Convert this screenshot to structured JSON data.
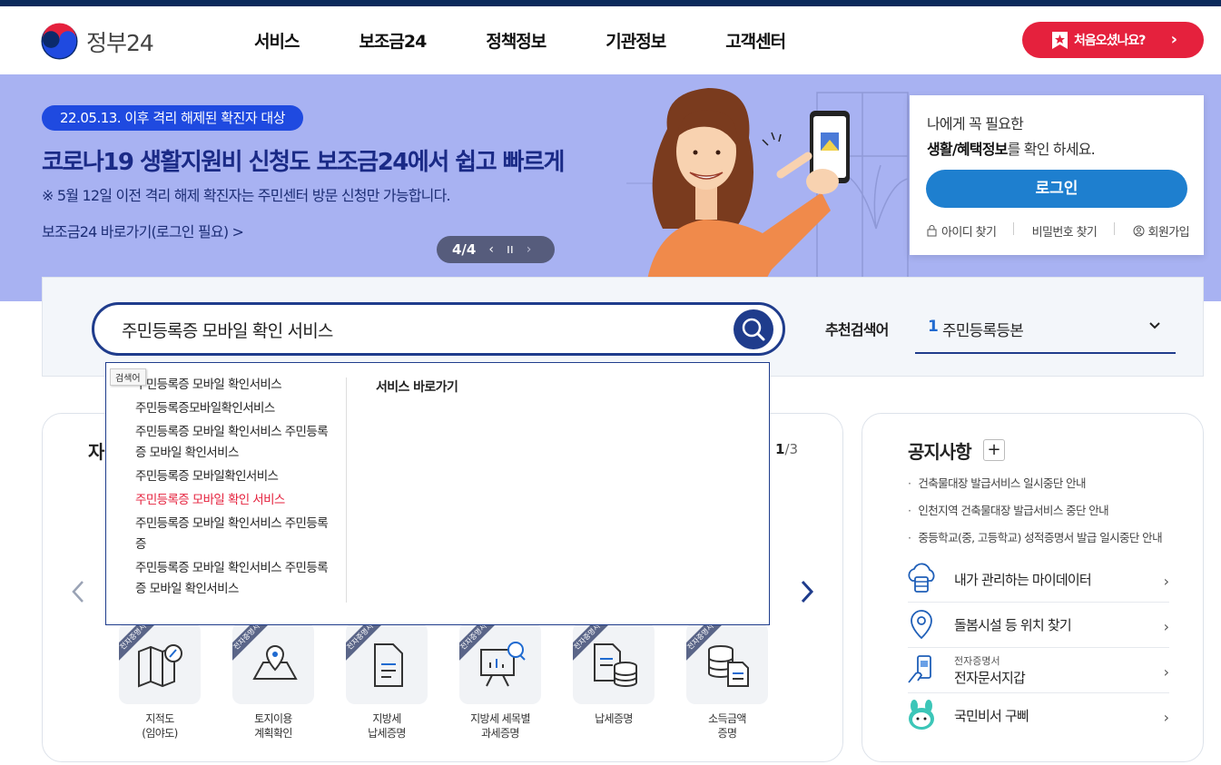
{
  "header": {
    "logo_text": "정부24",
    "nav": [
      "서비스",
      "보조금24",
      "정책정보",
      "기관정보",
      "고객센터"
    ],
    "first_visit_label": "처음오셨나요?"
  },
  "banner": {
    "badge": "22.05.13. 이후 격리 해제된 확진자 대상",
    "title": "코로나19 생활지원비 신청도 보조금24에서 쉽고 빠르게",
    "subtitle": "※ 5월 12일 이전 격리 해제 확진자는 주민센터 방문 신청만 가능합니다.",
    "link": "보조금24 바로가기(로그인 필요) >",
    "pager": "4/4"
  },
  "login": {
    "line1": "나에게 꼭 필요한",
    "line2_bold": "생활/혜택정보",
    "line2_rest": "를 확인 하세요.",
    "button": "로그인",
    "find_id": "아이디 찾기",
    "find_pw": "비밀번호 찾기",
    "signup": "회원가입"
  },
  "search": {
    "value": "주민등록증 모바일 확인 서비스",
    "recommend_label": "추천검색어",
    "recommend_num": "1",
    "recommend_text": "주민등록등본"
  },
  "autocomplete": {
    "tooltip": "검색어",
    "items": [
      {
        "text": "주민등록증 모바일 확인서비스",
        "hl": false
      },
      {
        "text": "주민등록증모바일확인서비스",
        "hl": false
      },
      {
        "text": "주민등록증 모바일 확인서비스 주민등록증 모바일 확인서비스",
        "hl": false
      },
      {
        "text": "주민등록증 모바일확인서비스",
        "hl": false
      },
      {
        "text": "주민등록증 모바일 확인 서비스",
        "hl": true
      },
      {
        "text": "주민등록증 모바일 확인서비스 주민등록증",
        "hl": false
      },
      {
        "text": "주민등록증 모바일 확인서비스 주민등록증 모바일 확인서비스",
        "hl": false
      }
    ],
    "right_title": "서비스 바로가기"
  },
  "services_card": {
    "title": "자",
    "page_current": "1",
    "page_total": "/3",
    "ribbon": "전자증명서",
    "items": [
      {
        "line1": "지적도",
        "line2": "(임야도)"
      },
      {
        "line1": "토지이용",
        "line2": "계획확인"
      },
      {
        "line1": "지방세",
        "line2": "납세증명"
      },
      {
        "line1": "지방세 세목별",
        "line2": "과세증명"
      },
      {
        "line1": "납세증명",
        "line2": ""
      },
      {
        "line1": "소득금액",
        "line2": "증명"
      }
    ]
  },
  "notice_card": {
    "title": "공지사항",
    "notices": [
      "건축물대장 발급서비스 일시중단 안내",
      "인천지역 건축물대장 발급서비스 중단 안내",
      "중등학교(중, 고등학교) 성적증명서 발급 일시중단 안내"
    ],
    "quick": [
      {
        "text": "내가 관리하는 마이데이터",
        "icon": "cloud-data-icon"
      },
      {
        "text": "돌봄시설 등 위치 찾기",
        "icon": "location-pin-icon"
      },
      {
        "sub": "전자증명서",
        "text": "전자문서지갑",
        "icon": "phone-wallet-icon"
      },
      {
        "text": "국민비서 구삐",
        "icon": "gubbi-character-icon"
      }
    ]
  }
}
